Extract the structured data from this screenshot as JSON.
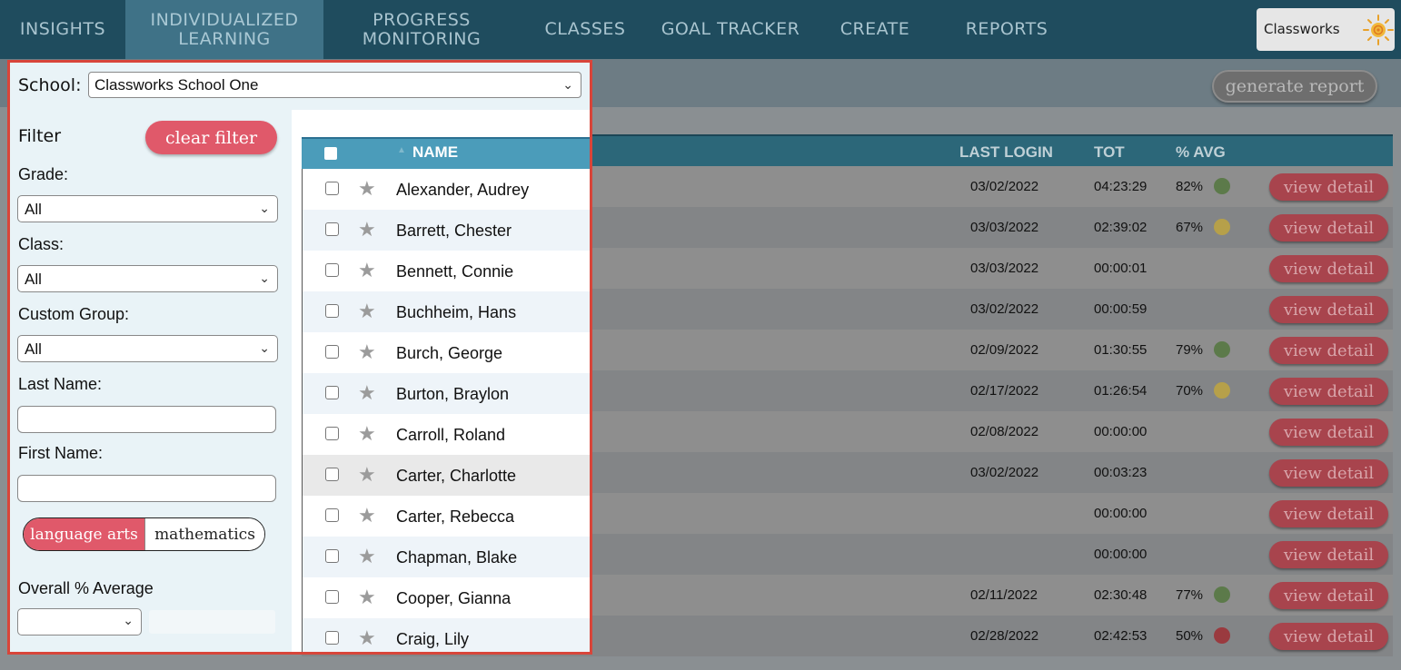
{
  "nav": {
    "items": [
      {
        "line1": "INSIGHTS",
        "line2": ""
      },
      {
        "line1": "INDIVIDUALIZED",
        "line2": "LEARNING"
      },
      {
        "line1": "PROGRESS",
        "line2": "MONITORING"
      },
      {
        "line1": "CLASSES",
        "line2": ""
      },
      {
        "line1": "GOAL TRACKER",
        "line2": ""
      },
      {
        "line1": "CREATE",
        "line2": ""
      },
      {
        "line1": "REPORTS",
        "line2": ""
      }
    ],
    "active_index": 1,
    "logo_text": "Classworks"
  },
  "school": {
    "label": "School:",
    "value": "Classworks School One"
  },
  "generate_report": "generate report",
  "filter": {
    "title": "Filter",
    "clear_label": "clear filter",
    "grade_label": "Grade:",
    "grade_value": "All",
    "class_label": "Class:",
    "class_value": "All",
    "group_label": "Custom Group:",
    "group_value": "All",
    "last_name_label": "Last Name:",
    "last_name_value": "",
    "first_name_label": "First Name:",
    "first_name_value": "",
    "subjects": [
      "language arts",
      "mathematics"
    ],
    "selected_subject": "language arts",
    "avg_label": "Overall % Average",
    "avg_value": ""
  },
  "table": {
    "headers": {
      "name": "NAME",
      "last_login": "LAST LOGIN",
      "tot": "TOT",
      "avg": "% AVG"
    },
    "sort_indicator": "▲",
    "view_label": "view detail",
    "rows": [
      {
        "name": "Alexander, Audrey",
        "last_login": "03/02/2022",
        "tot": "04:23:29",
        "avg": "82%",
        "status": "green"
      },
      {
        "name": "Barrett, Chester",
        "last_login": "03/03/2022",
        "tot": "02:39:02",
        "avg": "67%",
        "status": "yellow"
      },
      {
        "name": "Bennett, Connie",
        "last_login": "03/03/2022",
        "tot": "00:00:01",
        "avg": "",
        "status": ""
      },
      {
        "name": "Buchheim, Hans",
        "last_login": "03/02/2022",
        "tot": "00:00:59",
        "avg": "",
        "status": ""
      },
      {
        "name": "Burch, George",
        "last_login": "02/09/2022",
        "tot": "01:30:55",
        "avg": "79%",
        "status": "green"
      },
      {
        "name": "Burton, Braylon",
        "last_login": "02/17/2022",
        "tot": "01:26:54",
        "avg": "70%",
        "status": "yellow"
      },
      {
        "name": "Carroll, Roland",
        "last_login": "02/08/2022",
        "tot": "00:00:00",
        "avg": "",
        "status": ""
      },
      {
        "name": "Carter, Charlotte",
        "last_login": "03/02/2022",
        "tot": "00:03:23",
        "avg": "",
        "status": ""
      },
      {
        "name": "Carter, Rebecca",
        "last_login": "",
        "tot": "00:00:00",
        "avg": "",
        "status": ""
      },
      {
        "name": "Chapman, Blake",
        "last_login": "",
        "tot": "00:00:00",
        "avg": "",
        "status": ""
      },
      {
        "name": "Cooper, Gianna",
        "last_login": "02/11/2022",
        "tot": "02:30:48",
        "avg": "77%",
        "status": "green"
      },
      {
        "name": "Craig, Lily",
        "last_login": "02/28/2022",
        "tot": "02:42:53",
        "avg": "50%",
        "status": "red"
      }
    ],
    "highlighted_row": 7
  },
  "colors": {
    "nav_bg": "#1f4c5e",
    "accent_red": "#e0596a",
    "highlight_border": "#d8453a",
    "status_green": "#5c7a4a",
    "status_yellow": "#b6a04a",
    "status_red": "#9a3a3f"
  },
  "icons": {
    "star": "star-icon",
    "chevron": "chevron-down-icon",
    "logo": "sun-spiral-logo-icon"
  }
}
